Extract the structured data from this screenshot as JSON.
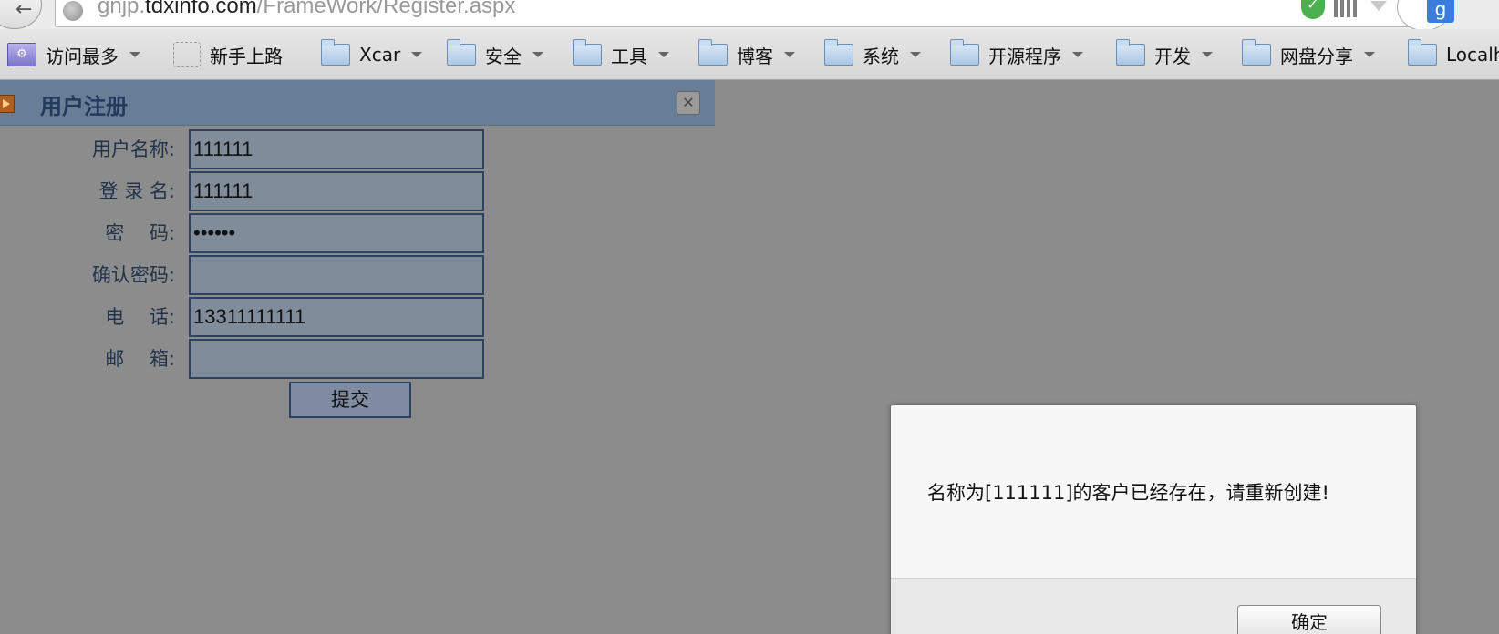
{
  "browser": {
    "url_prefix": "gnjp.",
    "url_domain": "tdxinfo.com",
    "url_path": "/FrameWork/Register.aspx"
  },
  "bookmarks": [
    {
      "label": "访问最多",
      "icon": "most-visited-icon",
      "dropdown": true
    },
    {
      "label": "新手上路",
      "icon": "blank-page-icon",
      "dropdown": false
    },
    {
      "label": "Xcar",
      "icon": "folder-icon",
      "dropdown": true
    },
    {
      "label": "安全",
      "icon": "folder-icon",
      "dropdown": true
    },
    {
      "label": "工具",
      "icon": "folder-icon",
      "dropdown": true
    },
    {
      "label": "博客",
      "icon": "folder-icon",
      "dropdown": true
    },
    {
      "label": "系统",
      "icon": "folder-icon",
      "dropdown": true
    },
    {
      "label": "开源程序",
      "icon": "folder-icon",
      "dropdown": true
    },
    {
      "label": "开发",
      "icon": "folder-icon",
      "dropdown": true
    },
    {
      "label": "网盘分享",
      "icon": "folder-icon",
      "dropdown": true
    },
    {
      "label": "Localh",
      "icon": "folder-icon",
      "dropdown": false
    }
  ],
  "panel": {
    "title": "用户注册"
  },
  "form": {
    "username_label": "用户名称:",
    "username_value": "111111",
    "login_label": "登 录 名:",
    "login_value": "111111",
    "password_label": "密　 码:",
    "password_value": "••••••",
    "confirm_label": "确认密码:",
    "confirm_value": "",
    "phone_label": "电　 话:",
    "phone_value": "13311111111",
    "email_label": "邮　 箱:",
    "email_value": "",
    "submit_label": "提交"
  },
  "alert": {
    "message": "名称为[111111]的客户已经存在，请重新创建!",
    "ok_label": "确定"
  },
  "colors": {
    "overlay": "#8c8c8c",
    "panel_header": "#687e97",
    "input_border": "#2d4161"
  }
}
